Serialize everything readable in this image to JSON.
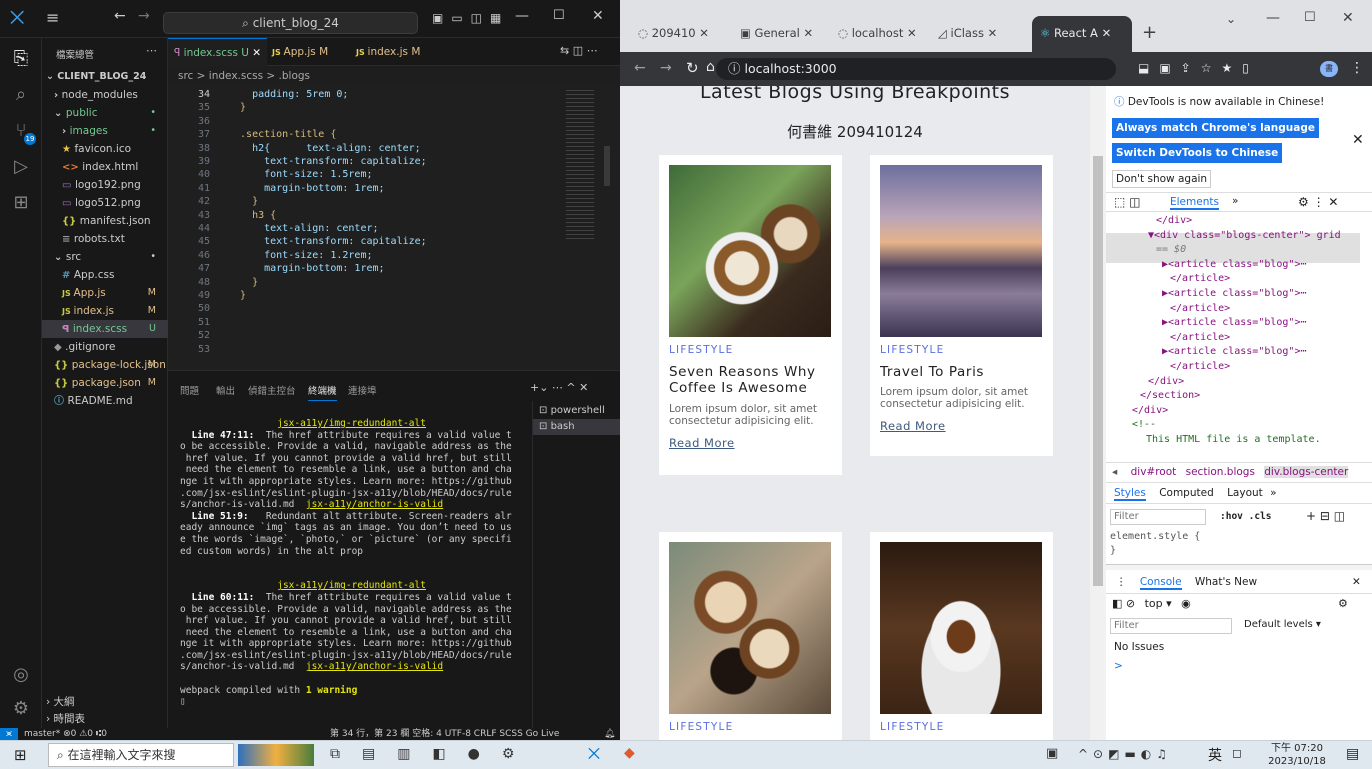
{
  "vscode": {
    "search": "client_blog_24",
    "explorer_title": "檔案總管",
    "root": "CLIENT_BLOG_24",
    "tree": [
      {
        "label": "node_modules",
        "color": "#ccc"
      },
      {
        "label": "public",
        "color": "#73c991",
        "status": "•"
      },
      {
        "label": "images",
        "color": "#73c991",
        "status": "•"
      },
      {
        "label": "favicon.ico",
        "color": "#ccc"
      },
      {
        "label": "index.html",
        "color": "#ccc"
      },
      {
        "label": "logo192.png",
        "color": "#ccc"
      },
      {
        "label": "logo512.png",
        "color": "#ccc"
      },
      {
        "label": "manifest.json",
        "color": "#ccc"
      },
      {
        "label": "robots.txt",
        "color": "#ccc"
      },
      {
        "label": "src",
        "color": "#ccc",
        "status": "•"
      },
      {
        "label": "App.css",
        "color": "#ccc"
      },
      {
        "label": "App.js",
        "color": "#e2c08d",
        "status": "M"
      },
      {
        "label": "index.js",
        "color": "#e2c08d",
        "status": "M"
      },
      {
        "label": "index.scss",
        "color": "#73c991",
        "status": "U"
      },
      {
        "label": ".gitignore",
        "color": "#ccc"
      },
      {
        "label": "package-lock.json",
        "color": "#e2c08d",
        "status": "M"
      },
      {
        "label": "package.json",
        "color": "#e2c08d",
        "status": "M"
      },
      {
        "label": "README.md",
        "color": "#ccc"
      }
    ],
    "outline": "大綱",
    "timeline": "時間表",
    "tabs": [
      {
        "label": "index.scss U",
        "color": "#73c991"
      },
      {
        "label": "App.js M",
        "color": "#e2c08d"
      },
      {
        "label": "index.js M",
        "color": "#e2c08d"
      }
    ],
    "breadcrumb": "src > index.scss > .blogs",
    "lines": [
      {
        "n": "34",
        "t": "    padding: 5rem 0;"
      },
      {
        "n": "35",
        "t": "  }"
      },
      {
        "n": "36",
        "t": ""
      },
      {
        "n": "37",
        "t": "  .section-title {"
      },
      {
        "n": "38",
        "t": "    h2{      text-align: center;"
      },
      {
        "n": "39",
        "t": "      text-transform: capitalize;"
      },
      {
        "n": "40",
        "t": "      font-size: 1.5rem;"
      },
      {
        "n": "41",
        "t": "      margin-bottom: 1rem;"
      },
      {
        "n": "42",
        "t": "    }"
      },
      {
        "n": "43",
        "t": "    h3 {"
      },
      {
        "n": "44",
        "t": "      text-align: center;"
      },
      {
        "n": "45",
        "t": "      text-transform: capitalize;"
      },
      {
        "n": "46",
        "t": "      font-size: 1.2rem;"
      },
      {
        "n": "47",
        "t": "      margin-bottom: 1rem;"
      },
      {
        "n": "48",
        "t": "    }"
      },
      {
        "n": "49",
        "t": "  }"
      },
      {
        "n": "50",
        "t": ""
      },
      {
        "n": "51",
        "t": ""
      },
      {
        "n": "52",
        "t": ""
      },
      {
        "n": "53",
        "t": ""
      }
    ],
    "panel_tabs": [
      "問題",
      "輸出",
      "偵錯主控台",
      "終端機",
      "連接埠"
    ],
    "terminals": [
      "powershell",
      "bash"
    ],
    "term": {
      "rule1": "jsx-a11y/img-redundant-alt",
      "w1a": "Line 47:11:",
      "w1b": "  The href attribute requires a valid value t",
      "w1c": "o be accessible. Provide a valid, navigable address as the\n href value. If you cannot provide a valid href, but still\n need the element to resemble a link, use a button and cha\nnge it with appropriate styles. Learn more: https://github\n.com/jsx-eslint/eslint-plugin-jsx-a11y/blob/HEAD/docs/rule\ns/anchor-is-valid.md  ",
      "w1rule": "jsx-a11y/anchor-is-valid",
      "w2a": "Line 51:9:",
      "w2b": "   Redundant alt attribute. Screen-readers alr",
      "w2c": "eady announce `img` tags as an image. You don’t need to us\ne the words `image`, `photo,` or `picture` (or any specifi\ned custom words) in the alt prop",
      "rule2": "jsx-a11y/img-redundant-alt",
      "w3a": "Line 60:11:",
      "w3b": "  The href attribute requires a valid value t",
      "w3c": "o be accessible. Provide a valid, navigable address as the\n href value. If you cannot provide a valid href, but still\n need the element to resemble a link, use a button and cha\nnge it with appropriate styles. Learn more: https://github\n.com/jsx-eslint/eslint-plugin-jsx-a11y/blob/HEAD/docs/rule\ns/anchor-is-valid.md  ",
      "w3rule": "jsx-a11y/anchor-is-valid",
      "done": "webpack compiled with ",
      "warn": "1 warning"
    },
    "status_left": "master*  ⊗0 ⚠0  ⑆0",
    "status_right": "第 34 行，第 23 欄   空格: 4   UTF-8   CRLF   SCSS   Go Live"
  },
  "chrome": {
    "tabs": [
      "209410",
      "General",
      "localhost",
      "iClass",
      "React A"
    ],
    "url": "localhost:3000",
    "page": {
      "heading": "Latest Blogs Using Breakpoints",
      "subheading": "何書維 209410124",
      "cards": [
        {
          "cat": "LIFESTYLE",
          "title": "Seven Reasons Why Coffee Is Awesome",
          "desc": "Lorem ipsum dolor, sit amet consectetur adipisicing elit.",
          "more": "Read More"
        },
        {
          "cat": "LIFESTYLE",
          "title": "Travel To Paris",
          "desc": "Lorem ipsum dolor, sit amet consectetur adipisicing elit.",
          "more": "Read More"
        },
        {
          "cat": "LIFESTYLE"
        },
        {
          "cat": "LIFESTYLE"
        }
      ]
    },
    "devtools": {
      "notice": "DevTools is now available in Chinese!",
      "btn1": "Always match Chrome's language",
      "btn2": "Switch DevTools to Chinese",
      "btn3": "Don't show again",
      "tab_elements": "Elements",
      "dom": [
        "</div>",
        "▼<div class=\"blogs-center\"> grid",
        "  == $0",
        "  ▶<article class=\"blog\">⋯",
        "   </article>",
        "  ▶<article class=\"blog\">⋯",
        "   </article>",
        "  ▶<article class=\"blog\">⋯",
        "   </article>",
        "  ▶<article class=\"blog\">⋯",
        "   </article>",
        " </div>",
        "</section>",
        "</div>",
        "<!--",
        "      This HTML file is a template."
      ],
      "crumbs": [
        "div#root",
        "section.blogs",
        "div.blogs-center"
      ],
      "styles_tabs": [
        "Styles",
        "Computed",
        "Layout"
      ],
      "filter": "Filter",
      "hov": ":hov .cls",
      "element_style": "element.style {",
      "close_brace": "}",
      "console_tabs": [
        "Console",
        "What's New"
      ],
      "top": "top",
      "filter2": "Filter",
      "levels": "Default levels",
      "no_issues": "No Issues",
      "prompt": ">"
    }
  },
  "taskbar": {
    "search": "在這裡輸入文字來搜",
    "ime": "英",
    "time": "下午 07:20",
    "date": "2023/10/18"
  }
}
